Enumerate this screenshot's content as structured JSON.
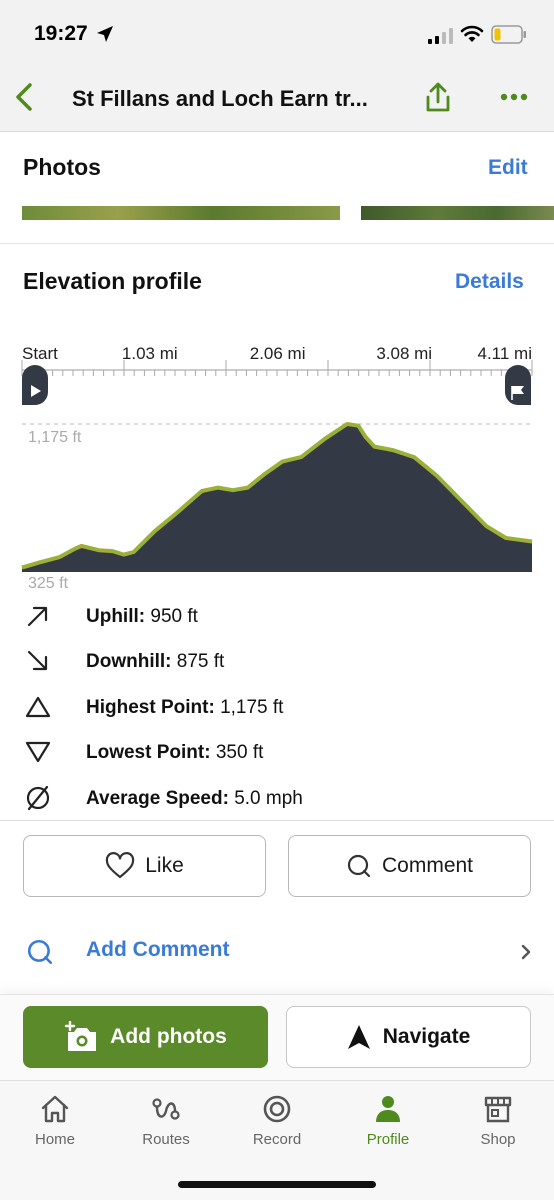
{
  "status_bar": {
    "time": "19:27"
  },
  "nav": {
    "title": "St Fillans and Loch Earn tr..."
  },
  "photos": {
    "title": "Photos",
    "edit_label": "Edit"
  },
  "elevation": {
    "title": "Elevation profile",
    "details_label": "Details",
    "max_label": "1,175 ft",
    "min_label": "325 ft"
  },
  "chart_data": {
    "type": "area",
    "xlabel": "",
    "ylabel": "",
    "x_ticks": [
      "Start",
      "1.03 mi",
      "2.06 mi",
      "3.08 mi",
      "4.11 mi"
    ],
    "x_tick_values": [
      0,
      1.03,
      2.06,
      3.08,
      4.11
    ],
    "ylim": [
      325,
      1175
    ],
    "colors": {
      "fill": "#343a45",
      "line": "#8ab83a",
      "line_alt": "#d4952a"
    },
    "series": [
      {
        "x": [
          0,
          0.14,
          0.3,
          0.43,
          0.48,
          0.62,
          0.73,
          0.82,
          0.9,
          1.07,
          1.24,
          1.45,
          1.58,
          1.7,
          1.82,
          1.96,
          2.1,
          2.25,
          2.44,
          2.62,
          2.71,
          2.77,
          2.84,
          2.99,
          3.16,
          3.34,
          3.54,
          3.74,
          3.9,
          4.11
        ],
        "y": [
          350,
          380,
          410,
          460,
          475,
          450,
          445,
          425,
          440,
          560,
          660,
          790,
          810,
          795,
          810,
          890,
          960,
          985,
          1090,
          1175,
          1165,
          1100,
          1045,
          1025,
          985,
          880,
          735,
          590,
          520,
          500
        ]
      }
    ]
  },
  "stats": [
    {
      "icon": "uphill-arrow-icon",
      "label": "Uphill:",
      "value": "950 ft"
    },
    {
      "icon": "downhill-arrow-icon",
      "label": "Downhill:",
      "value": "875 ft"
    },
    {
      "icon": "triangle-up-icon",
      "label": "Highest Point:",
      "value": "1,175 ft"
    },
    {
      "icon": "triangle-down-icon",
      "label": "Lowest Point:",
      "value": "350 ft"
    },
    {
      "icon": "average-speed-icon",
      "label": "Average Speed:",
      "value": "5.0 mph"
    }
  ],
  "social": {
    "like_label": "Like",
    "comment_label": "Comment",
    "add_comment_label": "Add Comment"
  },
  "actions": {
    "add_photos_label": "Add photos",
    "navigate_label": "Navigate"
  },
  "tabs": [
    {
      "label": "Home",
      "icon": "home-icon"
    },
    {
      "label": "Routes",
      "icon": "routes-icon"
    },
    {
      "label": "Record",
      "icon": "record-icon"
    },
    {
      "label": "Profile",
      "icon": "profile-icon",
      "active": true
    },
    {
      "label": "Shop",
      "icon": "shop-icon"
    }
  ],
  "theme": {
    "accent": "#5a8a2a",
    "link": "#3a7bd5"
  }
}
